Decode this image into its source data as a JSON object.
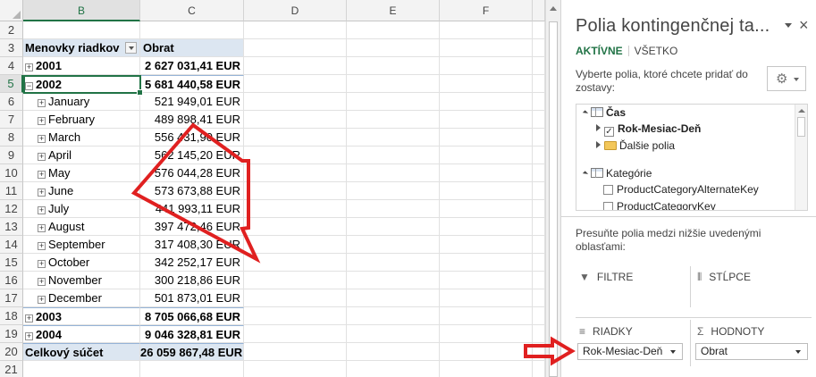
{
  "sheet": {
    "columns": [
      "B",
      "C",
      "D",
      "E",
      "F"
    ],
    "selected_column": "B",
    "selected_row": "5",
    "rows": [
      {
        "num": "2",
        "b": "",
        "c": ""
      },
      {
        "num": "3",
        "b": "Menovky riadkov",
        "c": "Obrat",
        "kind": "header"
      },
      {
        "num": "4",
        "b": "2001",
        "c": "2 627 031,41 EUR",
        "kind": "year",
        "toggle": "+"
      },
      {
        "num": "5",
        "b": "2002",
        "c": "5 681 440,58 EUR",
        "kind": "year",
        "toggle": "−"
      },
      {
        "num": "6",
        "b": "January",
        "c": "521 949,01 EUR",
        "kind": "month",
        "toggle": "+"
      },
      {
        "num": "7",
        "b": "February",
        "c": "489 898,41 EUR",
        "kind": "month",
        "toggle": "+"
      },
      {
        "num": "8",
        "b": "March",
        "c": "556 431,90 EUR",
        "kind": "month",
        "toggle": "+"
      },
      {
        "num": "9",
        "b": "April",
        "c": "562 145,20 EUR",
        "kind": "month",
        "toggle": "+"
      },
      {
        "num": "10",
        "b": "May",
        "c": "576 044,28 EUR",
        "kind": "month",
        "toggle": "+"
      },
      {
        "num": "11",
        "b": "June",
        "c": "573 673,88 EUR",
        "kind": "month",
        "toggle": "+"
      },
      {
        "num": "12",
        "b": "July",
        "c": "441 993,11 EUR",
        "kind": "month",
        "toggle": "+"
      },
      {
        "num": "13",
        "b": "August",
        "c": "397 472,46 EUR",
        "kind": "month",
        "toggle": "+"
      },
      {
        "num": "14",
        "b": "September",
        "c": "317 408,30 EUR",
        "kind": "month",
        "toggle": "+"
      },
      {
        "num": "15",
        "b": "October",
        "c": "342 252,17 EUR",
        "kind": "month",
        "toggle": "+"
      },
      {
        "num": "16",
        "b": "November",
        "c": "300 218,86 EUR",
        "kind": "month",
        "toggle": "+"
      },
      {
        "num": "17",
        "b": "December",
        "c": "501 873,01 EUR",
        "kind": "month",
        "toggle": "+"
      },
      {
        "num": "18",
        "b": "2003",
        "c": "8 705 066,68 EUR",
        "kind": "year",
        "toggle": "+"
      },
      {
        "num": "19",
        "b": "2004",
        "c": "9 046 328,81 EUR",
        "kind": "year",
        "toggle": "+"
      },
      {
        "num": "20",
        "b": "Celkový súčet",
        "c": "26 059 867,48 EUR",
        "kind": "total"
      },
      {
        "num": "21",
        "b": "",
        "c": ""
      }
    ]
  },
  "pane": {
    "title": "Polia kontingenčnej ta...",
    "tab_active": "AKTÍVNE",
    "tab_all": "VŠETKO",
    "instruction": "Vyberte polia, ktoré chcete pridať do zostavy:",
    "gear_icon": "gear-icon",
    "tree": {
      "table1": "Čas",
      "field1": "Rok-Mesiac-Deň",
      "field1_checked": "✓",
      "folder1": "Ďalšie polia",
      "table2": "Kategórie",
      "field2": "ProductCategoryAlternateKey",
      "field3": "ProductCategoryKey"
    },
    "areas_instruction": "Presuňte polia medzi nižšie uvedenými oblasťami:",
    "areas": {
      "filters": "FILTRE",
      "columns": "STĹPCE",
      "rows": "RIADKY",
      "values": "HODNOTY",
      "filters_icon": "▼",
      "columns_icon": "⦀",
      "rows_icon": "≡",
      "values_icon": "Σ",
      "rows_field": "Rok-Mesiac-Deň",
      "values_field": "Obrat"
    }
  },
  "colors": {
    "accent": "#217346",
    "pivot_header": "#dce6f1",
    "annotation": "#e02020"
  }
}
